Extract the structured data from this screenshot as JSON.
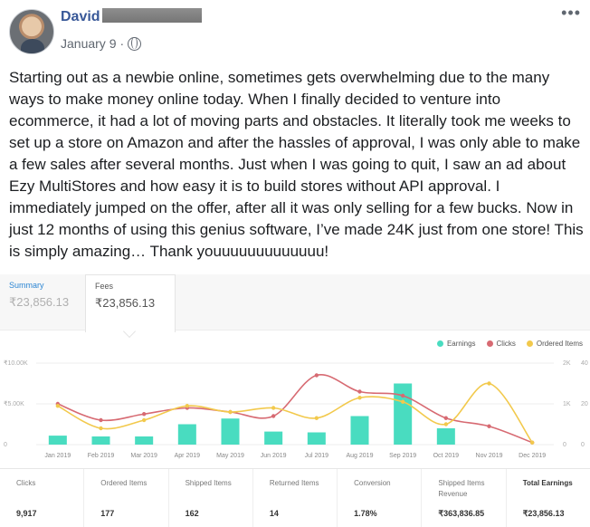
{
  "post": {
    "author": "David",
    "date": "January 9",
    "dot": "·",
    "more": "•••",
    "text": "Starting out as a newbie online, sometimes gets overwhelming due to the many ways to make money online today. When I finally decided to venture into ecommerce, it had a lot of moving parts and obstacles. It literally took me weeks to set up a store on Amazon and after the hassles of approval, I was only able to make a few sales after several months. Just when I was going to quit, I saw an ad about Ezy MultiStores and how easy it is to build stores without API approval. I immediately jumped on the offer, after all it was only selling for a few bucks. Now in just 12 months of using this genius software, I’ve made 24K just from one store! This is simply amazing… Thank youuuuuuuuuuuuu!"
  },
  "dashboard": {
    "tabs": [
      {
        "label": "Summary",
        "value": "₹23,856.13"
      },
      {
        "label": "Fees",
        "value": "₹23,856.13"
      }
    ],
    "stats": [
      {
        "label": "Clicks",
        "value": "9,917"
      },
      {
        "label": "Ordered Items",
        "value": "177"
      },
      {
        "label": "Shipped Items",
        "value": "162"
      },
      {
        "label": "Returned Items",
        "value": "14"
      },
      {
        "label": "Conversion",
        "value": "1.78%"
      },
      {
        "label": "Shipped Items Revenue",
        "value": "₹363,836.85"
      },
      {
        "label": "Total Earnings",
        "value": "₹23,856.13"
      }
    ]
  },
  "colors": {
    "earnings": "#49dcc0",
    "clicks": "#d76a72",
    "ordered": "#f2c94c",
    "link": "#385898"
  },
  "chart_data": {
    "type": "bar",
    "categories": [
      "Jan 2019",
      "Feb 2019",
      "Mar 2019",
      "Apr 2019",
      "May 2019",
      "Jun 2019",
      "Jul 2019",
      "Aug 2019",
      "Sep 2019",
      "Oct 2019",
      "Nov 2019",
      "Dec 2019"
    ],
    "left_ticks": [
      "₹10.00K",
      "₹5.00K",
      "0"
    ],
    "right_ticks_1": [
      "2K",
      "1K",
      "0"
    ],
    "right_ticks_2": [
      "40",
      "20",
      "0"
    ],
    "ylim_earnings": [
      0,
      10000
    ],
    "ylim_clicks": [
      0,
      2000
    ],
    "ylim_ordered": [
      0,
      40
    ],
    "legend": [
      "Earnings",
      "Clicks",
      "Ordered Items"
    ],
    "series": [
      {
        "name": "Earnings",
        "kind": "bar",
        "values": [
          1100,
          1000,
          1000,
          2500,
          3200,
          1600,
          1500,
          3500,
          7500,
          2000,
          0,
          0
        ]
      },
      {
        "name": "Clicks",
        "kind": "line",
        "values": [
          1000,
          600,
          750,
          900,
          800,
          700,
          1700,
          1300,
          1200,
          650,
          450,
          50
        ]
      },
      {
        "name": "Ordered Items",
        "kind": "line",
        "values": [
          19,
          8,
          12,
          19,
          16,
          18,
          13,
          23,
          21,
          10,
          30,
          1
        ]
      }
    ]
  }
}
